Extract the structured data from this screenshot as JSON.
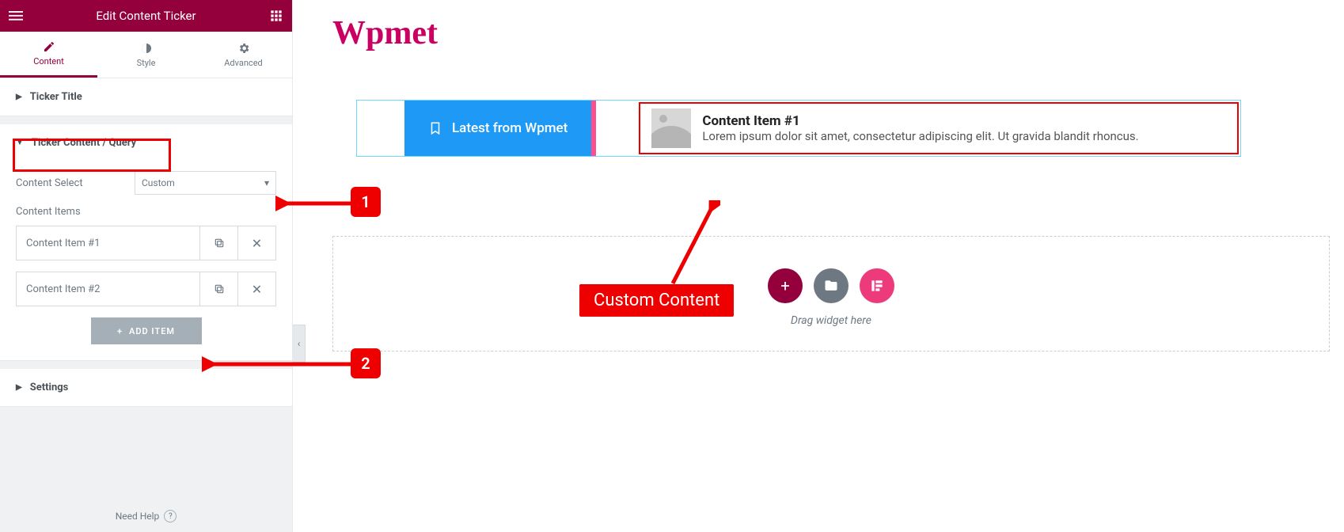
{
  "header": {
    "title": "Edit Content Ticker"
  },
  "tabs": {
    "content": "Content",
    "style": "Style",
    "advanced": "Advanced"
  },
  "sections": {
    "title": "Ticker Title",
    "query": "Ticker Content / Query",
    "settings": "Settings"
  },
  "controls": {
    "content_select_label": "Content Select",
    "content_select_value": "Custom",
    "content_items_label": "Content Items",
    "items": [
      "Content Item #1",
      "Content Item #2"
    ],
    "add_item": "ADD ITEM"
  },
  "footer": {
    "need_help": "Need Help"
  },
  "preview": {
    "brand": "Wpmet",
    "ticker_label": "Latest from Wpmet",
    "ticker": {
      "title": "Content Item #1",
      "desc": "Lorem ipsum dolor sit amet, consectetur adipiscing elit. Ut gravida blandit rhoncus."
    },
    "drop_hint": "Drag widget here"
  },
  "annotations": {
    "num1": "1",
    "num2": "2",
    "label": "Custom Content"
  }
}
